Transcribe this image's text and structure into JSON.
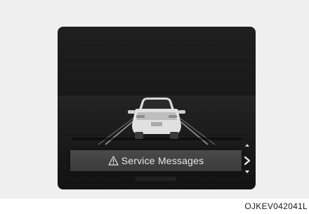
{
  "message_bar": {
    "icon": "warning-triangle-icon",
    "label": "Service Messages"
  },
  "navigation": {
    "next_icon": "chevron-right-icon",
    "scroll_up_icon": "arrow-up-icon",
    "scroll_down_icon": "arrow-down-icon"
  },
  "vehicle": {
    "icon": "car-rear-view-icon"
  },
  "figure_code": "OJKEV042041L"
}
